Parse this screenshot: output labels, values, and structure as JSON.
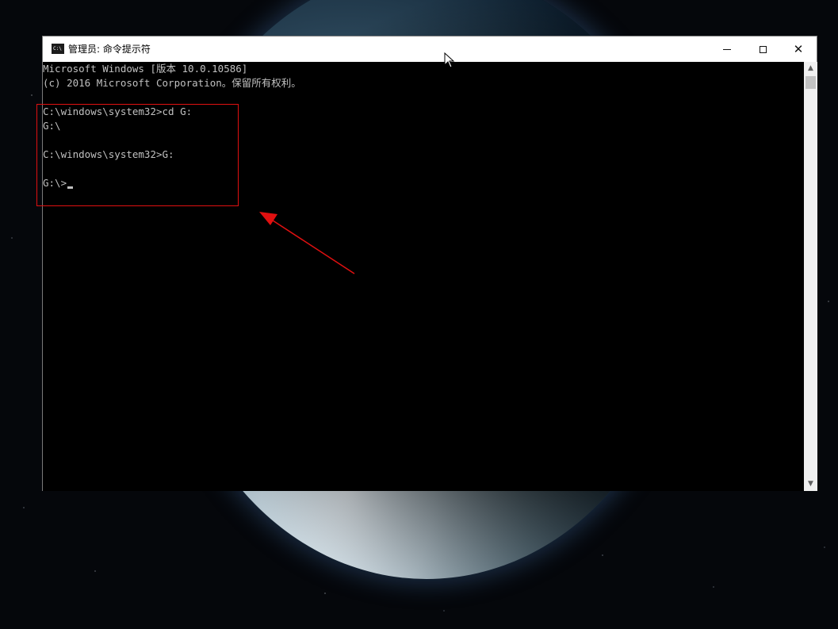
{
  "window": {
    "title": "管理员: 命令提示符",
    "app_icon_text": "C:\\"
  },
  "controls": {
    "minimize": "minimize",
    "maximize": "maximize",
    "close": "✕"
  },
  "console": {
    "lines": [
      "Microsoft Windows [版本 10.0.10586]",
      "(c) 2016 Microsoft Corporation。保留所有权利。",
      "",
      "C:\\windows\\system32>cd G:",
      "G:\\",
      "",
      "C:\\windows\\system32>G:",
      "",
      "G:\\>"
    ]
  },
  "colors": {
    "console_bg": "#000000",
    "console_text": "#c0c0c0",
    "annotation": "#e01010"
  },
  "icons": {
    "scroll_up": "chevron-up-icon",
    "scroll_down": "chevron-down-icon"
  }
}
